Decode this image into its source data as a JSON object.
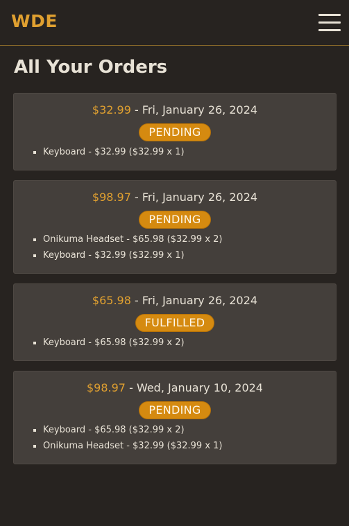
{
  "header": {
    "brand": "WDE",
    "menu_icon": "hamburger-menu-icon"
  },
  "page": {
    "title": "All Your Orders"
  },
  "orders": [
    {
      "total": "$32.99",
      "separator": " - ",
      "date": "Fri, January 26, 2024",
      "status": "PENDING",
      "items": [
        "Keyboard - $32.99 ($32.99 x 1)"
      ]
    },
    {
      "total": "$98.97",
      "separator": " - ",
      "date": "Fri, January 26, 2024",
      "status": "PENDING",
      "items": [
        "Onikuma Headset - $65.98 ($32.99 x 2)",
        "Keyboard - $32.99 ($32.99 x 1)"
      ]
    },
    {
      "total": "$65.98",
      "separator": " - ",
      "date": "Fri, January 26, 2024",
      "status": "FULFILLED",
      "items": [
        "Keyboard - $65.98 ($32.99 x 2)"
      ]
    },
    {
      "total": "$98.97",
      "separator": " - ",
      "date": "Wed, January 10, 2024",
      "status": "PENDING",
      "items": [
        "Keyboard - $65.98 ($32.99 x 2)",
        "Onikuma Headset - $32.99 ($32.99 x 1)"
      ]
    }
  ],
  "colors": {
    "background": "#272320",
    "card": "#443f3b",
    "accent": "#e0a030",
    "badge": "#d58a10",
    "text": "#e8e2d6"
  }
}
